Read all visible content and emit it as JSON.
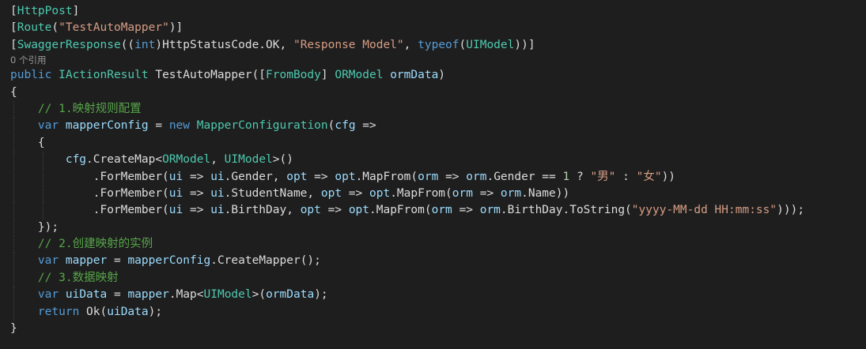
{
  "code": {
    "lines": [
      {
        "kind": "code",
        "tokens": [
          {
            "t": "[",
            "c": "plain"
          },
          {
            "t": "HttpPost",
            "c": "type"
          },
          {
            "t": "]",
            "c": "plain"
          }
        ]
      },
      {
        "kind": "code",
        "tokens": [
          {
            "t": "[",
            "c": "plain"
          },
          {
            "t": "Route",
            "c": "type"
          },
          {
            "t": "(",
            "c": "plain"
          },
          {
            "t": "\"TestAutoMapper\"",
            "c": "str"
          },
          {
            "t": ")]",
            "c": "plain"
          }
        ]
      },
      {
        "kind": "code",
        "tokens": [
          {
            "t": "[",
            "c": "plain"
          },
          {
            "t": "SwaggerResponse",
            "c": "type"
          },
          {
            "t": "((",
            "c": "plain"
          },
          {
            "t": "int",
            "c": "kw"
          },
          {
            "t": ")HttpStatusCode.OK, ",
            "c": "plain"
          },
          {
            "t": "\"Response Model\"",
            "c": "str"
          },
          {
            "t": ", ",
            "c": "plain"
          },
          {
            "t": "typeof",
            "c": "kw"
          },
          {
            "t": "(",
            "c": "plain"
          },
          {
            "t": "UIModel",
            "c": "type"
          },
          {
            "t": "))]",
            "c": "plain"
          }
        ]
      },
      {
        "kind": "codelens",
        "text": "0 个引用"
      },
      {
        "kind": "code",
        "tokens": [
          {
            "t": "public ",
            "c": "kw"
          },
          {
            "t": "IActionResult",
            "c": "type"
          },
          {
            "t": " ",
            "c": "plain"
          },
          {
            "t": "TestAutoMapper",
            "c": "plain"
          },
          {
            "t": "([",
            "c": "plain"
          },
          {
            "t": "FromBody",
            "c": "type"
          },
          {
            "t": "] ",
            "c": "plain"
          },
          {
            "t": "ORModel",
            "c": "type"
          },
          {
            "t": " ",
            "c": "plain"
          },
          {
            "t": "ormData",
            "c": "var"
          },
          {
            "t": ")",
            "c": "plain"
          }
        ]
      },
      {
        "kind": "code",
        "tokens": [
          {
            "t": "{",
            "c": "plain"
          }
        ]
      },
      {
        "kind": "code",
        "guides": [
          1
        ],
        "tokens": [
          {
            "t": "    ",
            "c": "plain"
          },
          {
            "t": "// 1.映射规则配置",
            "c": "com"
          }
        ]
      },
      {
        "kind": "code",
        "guides": [
          1
        ],
        "tokens": [
          {
            "t": "    ",
            "c": "plain"
          },
          {
            "t": "var",
            "c": "kw"
          },
          {
            "t": " ",
            "c": "plain"
          },
          {
            "t": "mapperConfig",
            "c": "var"
          },
          {
            "t": " = ",
            "c": "plain"
          },
          {
            "t": "new",
            "c": "kw"
          },
          {
            "t": " ",
            "c": "plain"
          },
          {
            "t": "MapperConfiguration",
            "c": "type"
          },
          {
            "t": "(",
            "c": "plain"
          },
          {
            "t": "cfg",
            "c": "var"
          },
          {
            "t": " =>",
            "c": "plain"
          }
        ]
      },
      {
        "kind": "code",
        "guides": [
          1
        ],
        "tokens": [
          {
            "t": "    {",
            "c": "plain"
          }
        ]
      },
      {
        "kind": "code",
        "guides": [
          1,
          2
        ],
        "tokens": [
          {
            "t": "        ",
            "c": "plain"
          },
          {
            "t": "cfg",
            "c": "var"
          },
          {
            "t": ".",
            "c": "plain"
          },
          {
            "t": "CreateMap",
            "c": "plain"
          },
          {
            "t": "<",
            "c": "plain"
          },
          {
            "t": "ORModel",
            "c": "type"
          },
          {
            "t": ", ",
            "c": "plain"
          },
          {
            "t": "UIModel",
            "c": "type"
          },
          {
            "t": ">()",
            "c": "plain"
          }
        ]
      },
      {
        "kind": "code",
        "guides": [
          1,
          2
        ],
        "tokens": [
          {
            "t": "            .ForMember(",
            "c": "plain"
          },
          {
            "t": "ui",
            "c": "var"
          },
          {
            "t": " => ",
            "c": "plain"
          },
          {
            "t": "ui",
            "c": "var"
          },
          {
            "t": ".Gender, ",
            "c": "plain"
          },
          {
            "t": "opt",
            "c": "var"
          },
          {
            "t": " => ",
            "c": "plain"
          },
          {
            "t": "opt",
            "c": "var"
          },
          {
            "t": ".MapFrom(",
            "c": "plain"
          },
          {
            "t": "orm",
            "c": "var"
          },
          {
            "t": " => ",
            "c": "plain"
          },
          {
            "t": "orm",
            "c": "var"
          },
          {
            "t": ".Gender == ",
            "c": "plain"
          },
          {
            "t": "1",
            "c": "num"
          },
          {
            "t": " ? ",
            "c": "plain"
          },
          {
            "t": "\"男\"",
            "c": "str"
          },
          {
            "t": " : ",
            "c": "plain"
          },
          {
            "t": "\"女\"",
            "c": "str"
          },
          {
            "t": "))",
            "c": "plain"
          }
        ]
      },
      {
        "kind": "code",
        "guides": [
          1,
          2
        ],
        "tokens": [
          {
            "t": "            .ForMember(",
            "c": "plain"
          },
          {
            "t": "ui",
            "c": "var"
          },
          {
            "t": " => ",
            "c": "plain"
          },
          {
            "t": "ui",
            "c": "var"
          },
          {
            "t": ".StudentName, ",
            "c": "plain"
          },
          {
            "t": "opt",
            "c": "var"
          },
          {
            "t": " => ",
            "c": "plain"
          },
          {
            "t": "opt",
            "c": "var"
          },
          {
            "t": ".MapFrom(",
            "c": "plain"
          },
          {
            "t": "orm",
            "c": "var"
          },
          {
            "t": " => ",
            "c": "plain"
          },
          {
            "t": "orm",
            "c": "var"
          },
          {
            "t": ".Name))",
            "c": "plain"
          }
        ]
      },
      {
        "kind": "code",
        "guides": [
          1,
          2
        ],
        "tokens": [
          {
            "t": "            .ForMember(",
            "c": "plain"
          },
          {
            "t": "ui",
            "c": "var"
          },
          {
            "t": " => ",
            "c": "plain"
          },
          {
            "t": "ui",
            "c": "var"
          },
          {
            "t": ".BirthDay, ",
            "c": "plain"
          },
          {
            "t": "opt",
            "c": "var"
          },
          {
            "t": " => ",
            "c": "plain"
          },
          {
            "t": "opt",
            "c": "var"
          },
          {
            "t": ".MapFrom(",
            "c": "plain"
          },
          {
            "t": "orm",
            "c": "var"
          },
          {
            "t": " => ",
            "c": "plain"
          },
          {
            "t": "orm",
            "c": "var"
          },
          {
            "t": ".BirthDay.ToString(",
            "c": "plain"
          },
          {
            "t": "\"yyyy-MM-dd HH:mm:ss\"",
            "c": "str"
          },
          {
            "t": ")));",
            "c": "plain"
          }
        ]
      },
      {
        "kind": "code",
        "guides": [
          1
        ],
        "tokens": [
          {
            "t": "    });",
            "c": "plain"
          }
        ]
      },
      {
        "kind": "code",
        "guides": [
          1
        ],
        "tokens": [
          {
            "t": "    ",
            "c": "plain"
          },
          {
            "t": "// 2.创建映射的实例",
            "c": "com"
          }
        ]
      },
      {
        "kind": "code",
        "guides": [
          1
        ],
        "tokens": [
          {
            "t": "    ",
            "c": "plain"
          },
          {
            "t": "var",
            "c": "kw"
          },
          {
            "t": " ",
            "c": "plain"
          },
          {
            "t": "mapper",
            "c": "var"
          },
          {
            "t": " = ",
            "c": "plain"
          },
          {
            "t": "mapperConfig",
            "c": "var"
          },
          {
            "t": ".CreateMapper();",
            "c": "plain"
          }
        ]
      },
      {
        "kind": "code",
        "guides": [
          1
        ],
        "tokens": [
          {
            "t": "    ",
            "c": "plain"
          },
          {
            "t": "// 3.数据映射",
            "c": "com"
          }
        ]
      },
      {
        "kind": "code",
        "guides": [
          1
        ],
        "tokens": [
          {
            "t": "    ",
            "c": "plain"
          },
          {
            "t": "var",
            "c": "kw"
          },
          {
            "t": " ",
            "c": "plain"
          },
          {
            "t": "uiData",
            "c": "var"
          },
          {
            "t": " = ",
            "c": "plain"
          },
          {
            "t": "mapper",
            "c": "var"
          },
          {
            "t": ".Map<",
            "c": "plain"
          },
          {
            "t": "UIModel",
            "c": "type"
          },
          {
            "t": ">(",
            "c": "plain"
          },
          {
            "t": "ormData",
            "c": "var"
          },
          {
            "t": ");",
            "c": "plain"
          }
        ]
      },
      {
        "kind": "code",
        "guides": [
          1
        ],
        "tokens": [
          {
            "t": "    ",
            "c": "plain"
          },
          {
            "t": "return",
            "c": "kw"
          },
          {
            "t": " Ok(",
            "c": "plain"
          },
          {
            "t": "uiData",
            "c": "var"
          },
          {
            "t": ");",
            "c": "plain"
          }
        ]
      },
      {
        "kind": "code",
        "tokens": [
          {
            "t": "}",
            "c": "plain"
          }
        ]
      }
    ]
  },
  "colors": {
    "background": "#1e1e1e",
    "plain": "#dcdcdc",
    "keyword": "#569cd6",
    "type": "#4ec9b0",
    "string": "#d69d85",
    "comment": "#57a64a",
    "number": "#b5cea8",
    "variable": "#9cdcfe",
    "codelens": "#999999"
  }
}
